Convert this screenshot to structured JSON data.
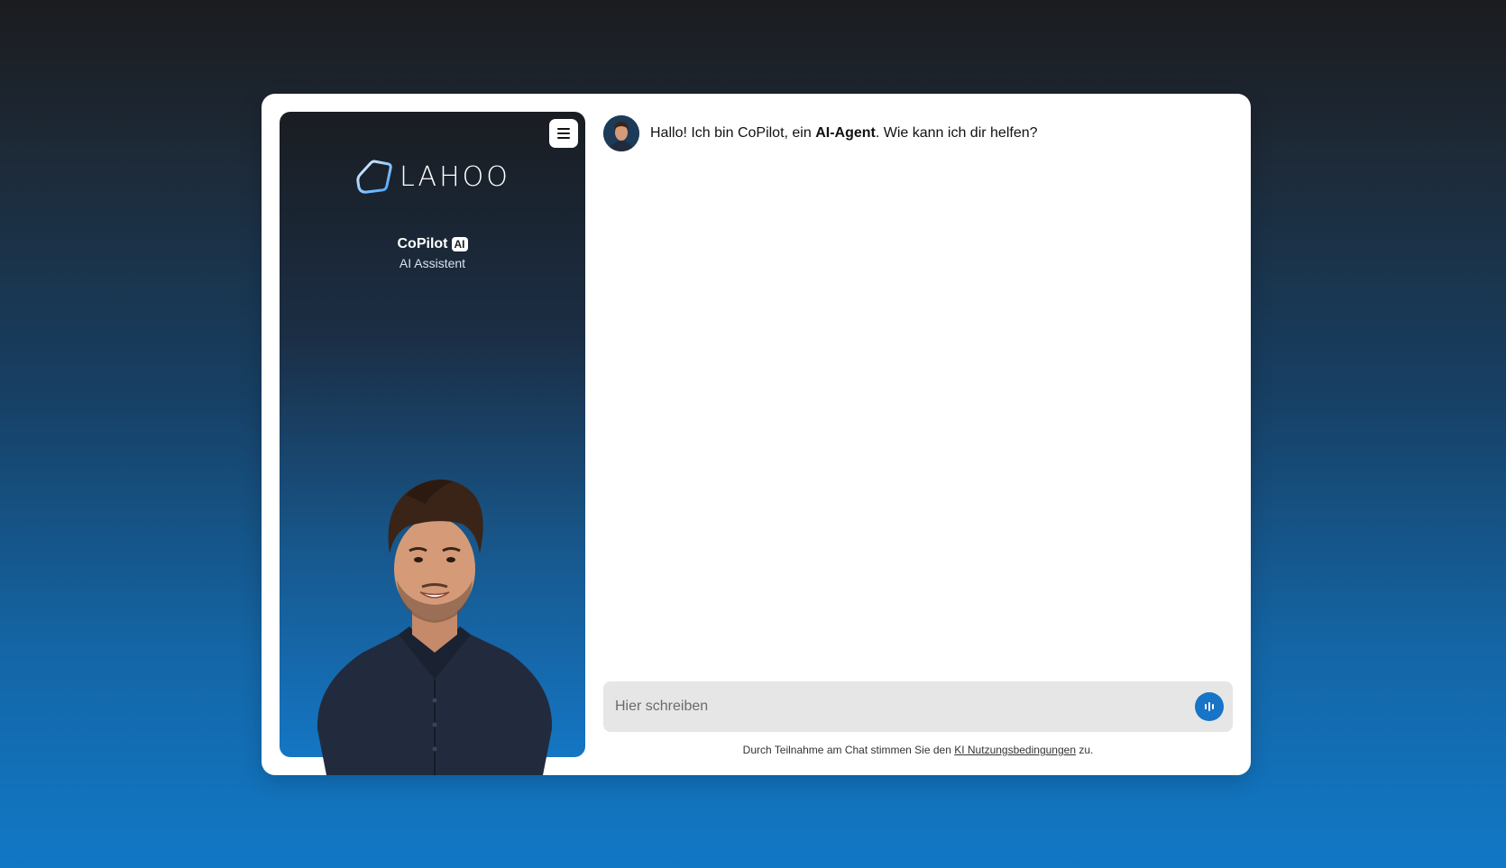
{
  "sidebar": {
    "brand": "LAHOO",
    "agent_name": "CoPilot",
    "agent_badge": "AI",
    "agent_role": "AI Assistent"
  },
  "chat": {
    "greeting_prefix": "Hallo! Ich bin CoPilot, ein ",
    "greeting_bold": "AI-Agent",
    "greeting_suffix": ". Wie kann ich dir helfen?"
  },
  "composer": {
    "placeholder": "Hier schreiben"
  },
  "terms": {
    "prefix": "Durch Teilnahme am Chat stimmen Sie den ",
    "link": "KI Nutzungsbedingungen",
    "suffix": " zu."
  },
  "colors": {
    "accent": "#1774c7",
    "sidebar_top": "#1a1d22",
    "sidebar_bottom": "#1476c4"
  },
  "icons": {
    "menu": "hamburger-menu-icon",
    "voice": "audio-wave-icon"
  }
}
